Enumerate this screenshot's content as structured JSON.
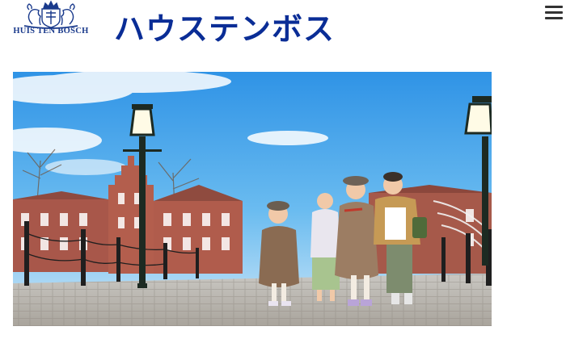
{
  "header": {
    "logo_text": "HUIS TEN BOSCH",
    "site_title": "ハウステンボス",
    "menu_icon": "hamburger-menu-icon"
  },
  "hero": {
    "image_subject": "family-walking-on-bridge-photo"
  },
  "colors": {
    "brand_blue": "#0a2d96",
    "logo_blue": "#1a3a8c"
  }
}
